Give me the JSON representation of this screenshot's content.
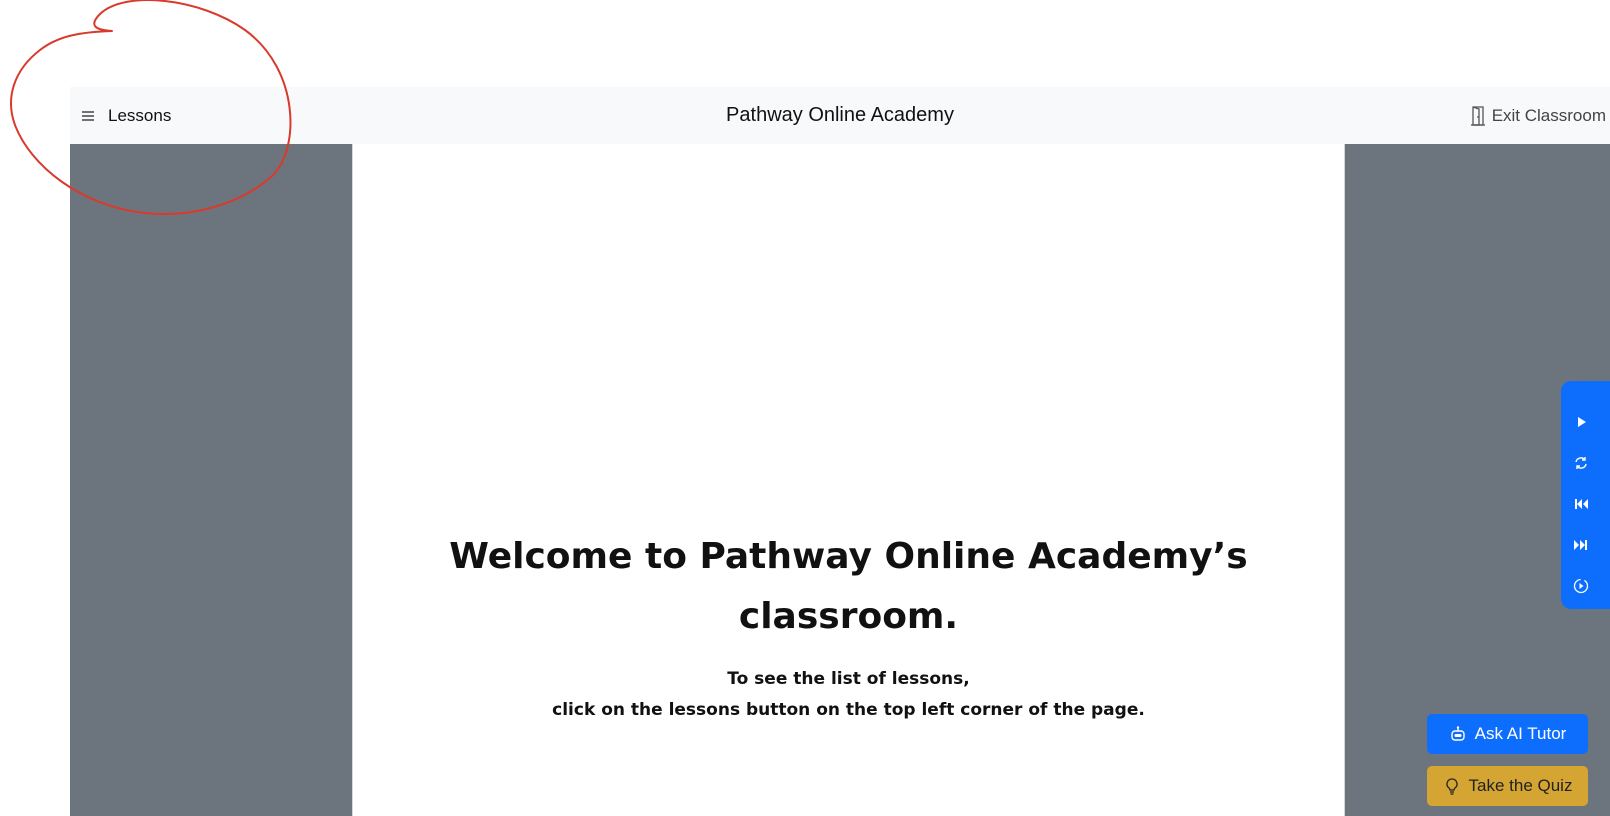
{
  "navbar": {
    "lessons_label": "Lessons",
    "lessons_icon": "menu-icon",
    "brand": "Pathway Online Academy",
    "exit_label": "Exit Classroom",
    "exit_icon": "door-icon"
  },
  "content": {
    "welcome_title_line1": "Welcome to Pathway Online Academy’s",
    "welcome_title_line2": "classroom.",
    "welcome_sub_line1": "To see the list of lessons,",
    "welcome_sub_line2": "click on the lessons button on the top left corner of the page."
  },
  "media_controls": {
    "items": [
      "play-icon",
      "replay-icon",
      "skip-back-icon",
      "skip-forward-icon",
      "autoplay-icon"
    ]
  },
  "actions": {
    "ai_tutor_label": "Ask AI Tutor",
    "ai_tutor_icon": "robot-icon",
    "quiz_label": "Take the Quiz",
    "quiz_icon": "lightbulb-icon"
  },
  "colors": {
    "primary": "#0d6efd",
    "quiz": "#d4a533",
    "sidebar": "#6c757d",
    "navbar": "#f8f9fa",
    "annotation": "#d93a2b"
  }
}
